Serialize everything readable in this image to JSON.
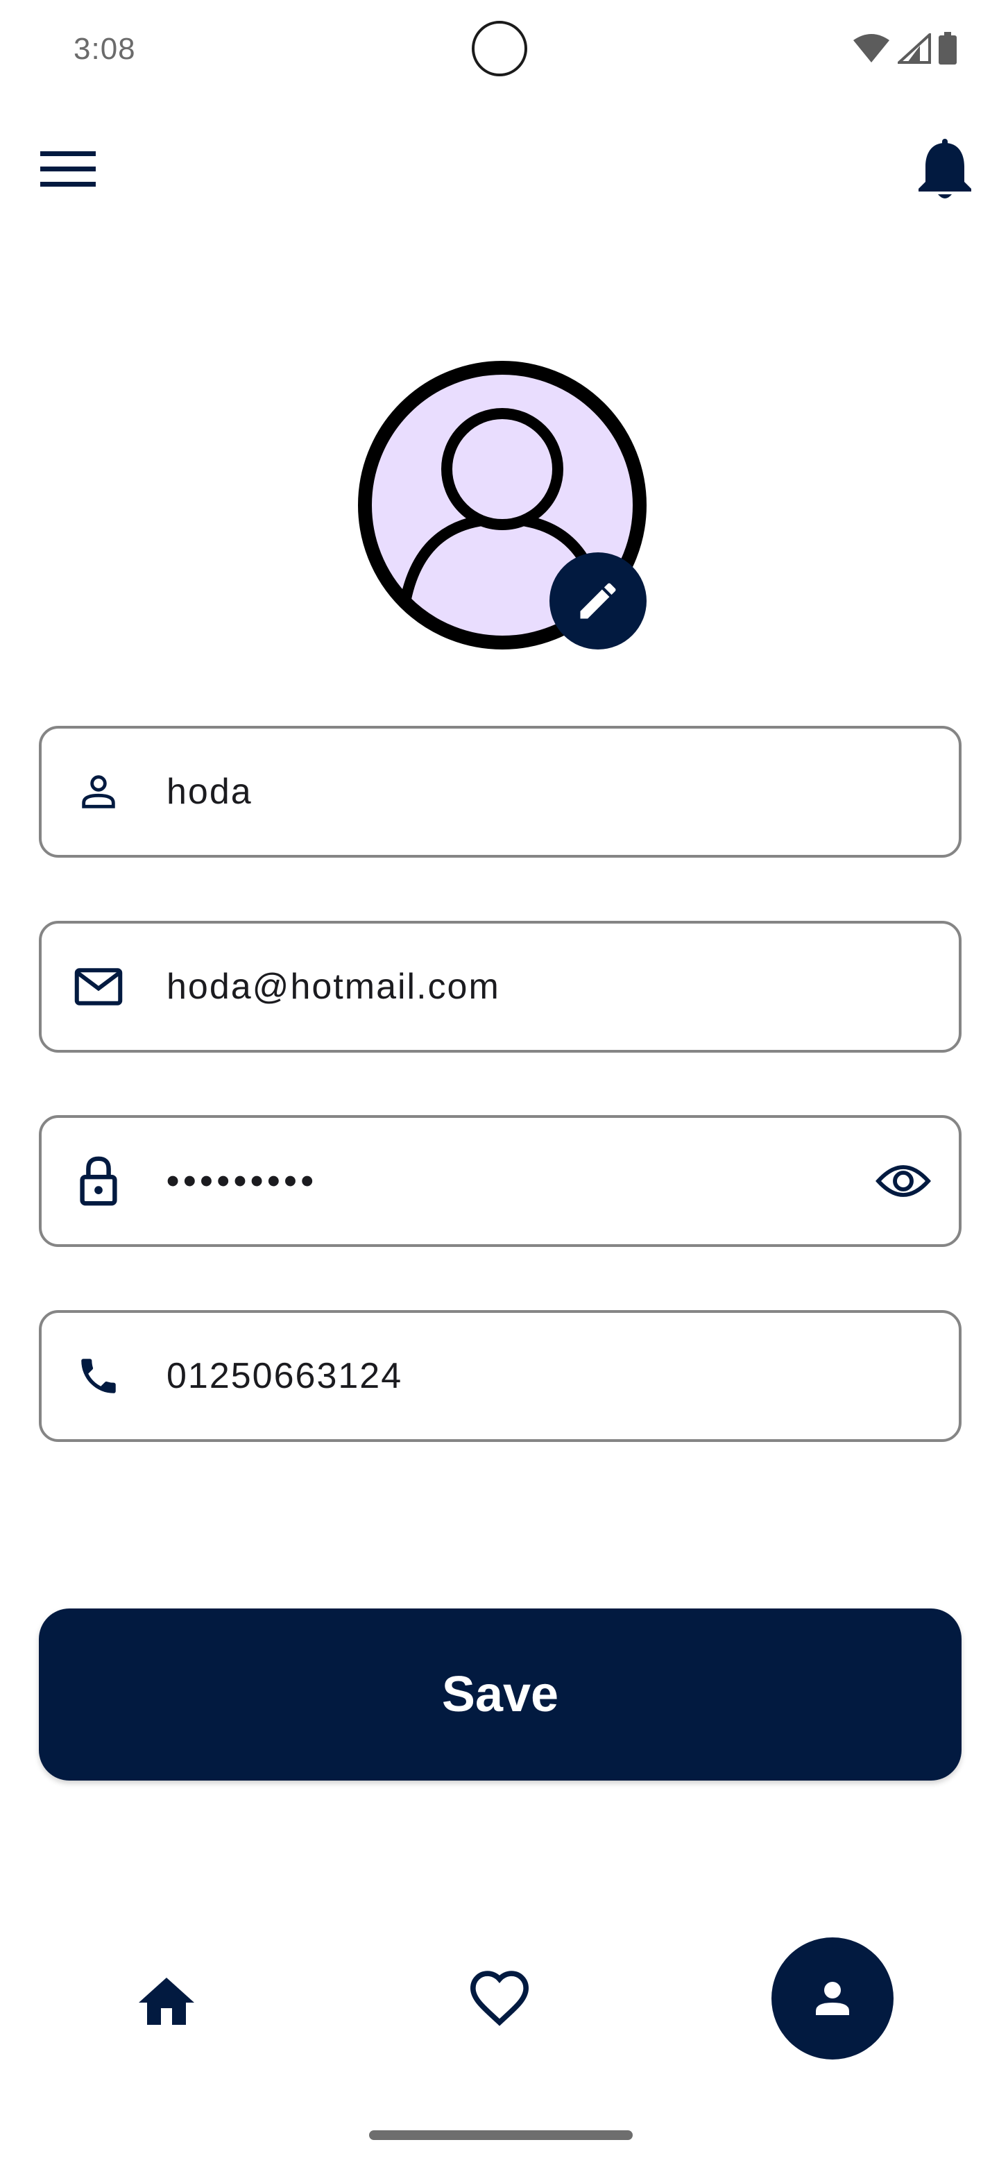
{
  "status_bar": {
    "time": "3:08",
    "icons": [
      "wifi-icon",
      "cell-signal-icon",
      "battery-icon"
    ]
  },
  "app_bar": {
    "menu_icon": "menu-icon",
    "notification_icon": "bell-icon"
  },
  "profile": {
    "avatar_icon": "person-icon",
    "edit_icon": "pencil-icon"
  },
  "form": {
    "name": {
      "icon": "person-outline-icon",
      "value": "hoda"
    },
    "email": {
      "icon": "mail-icon",
      "value": "hoda@hotmail.com"
    },
    "password": {
      "icon": "lock-icon",
      "value": "•••••••••",
      "toggle_icon": "eye-icon"
    },
    "phone": {
      "icon": "phone-icon",
      "value": "01250663124"
    }
  },
  "save_button": {
    "label": "Save"
  },
  "bottom_nav": {
    "items": [
      {
        "name": "home",
        "icon": "home-icon"
      },
      {
        "name": "favorites",
        "icon": "heart-icon"
      },
      {
        "name": "profile",
        "icon": "person-icon",
        "active": true
      }
    ]
  },
  "colors": {
    "primary": "#021a40",
    "avatar_fill": "#e9ddfe",
    "field_border": "#858585",
    "background": "#ffffff"
  }
}
